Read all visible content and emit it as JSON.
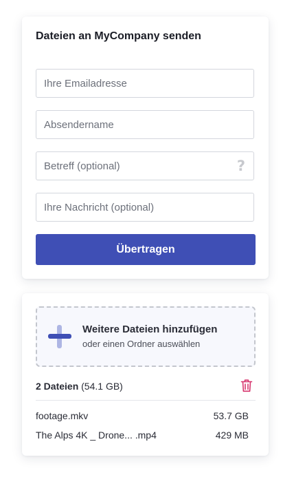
{
  "form": {
    "title": "Dateien an MyCompany senden",
    "email_placeholder": "Ihre Emailadresse",
    "sender_placeholder": "Absendername",
    "subject_placeholder": "Betreff (optional)",
    "subject_help": "?",
    "message_placeholder": "Ihre Nachricht (optional)",
    "submit_label": "Übertragen"
  },
  "files": {
    "dropzone_title": "Weitere Dateien hinzufügen",
    "dropzone_subtitle": "oder einen Ordner auswählen",
    "count_label": "2 Dateien",
    "total_size": "(54.1 GB)",
    "items": [
      {
        "name": "footage.mkv",
        "size": "53.7 GB"
      },
      {
        "name": "The Alps 4K _ Drone... .mp4",
        "size": "429 MB"
      }
    ]
  },
  "colors": {
    "accent": "#3f4fb5",
    "accent_light": "#aeb6e4",
    "danger": "#d6336c",
    "help_icon": "#c7c9ce"
  },
  "icons": {
    "add": "plus-icon",
    "delete": "trash-icon",
    "help": "question-mark-icon"
  }
}
